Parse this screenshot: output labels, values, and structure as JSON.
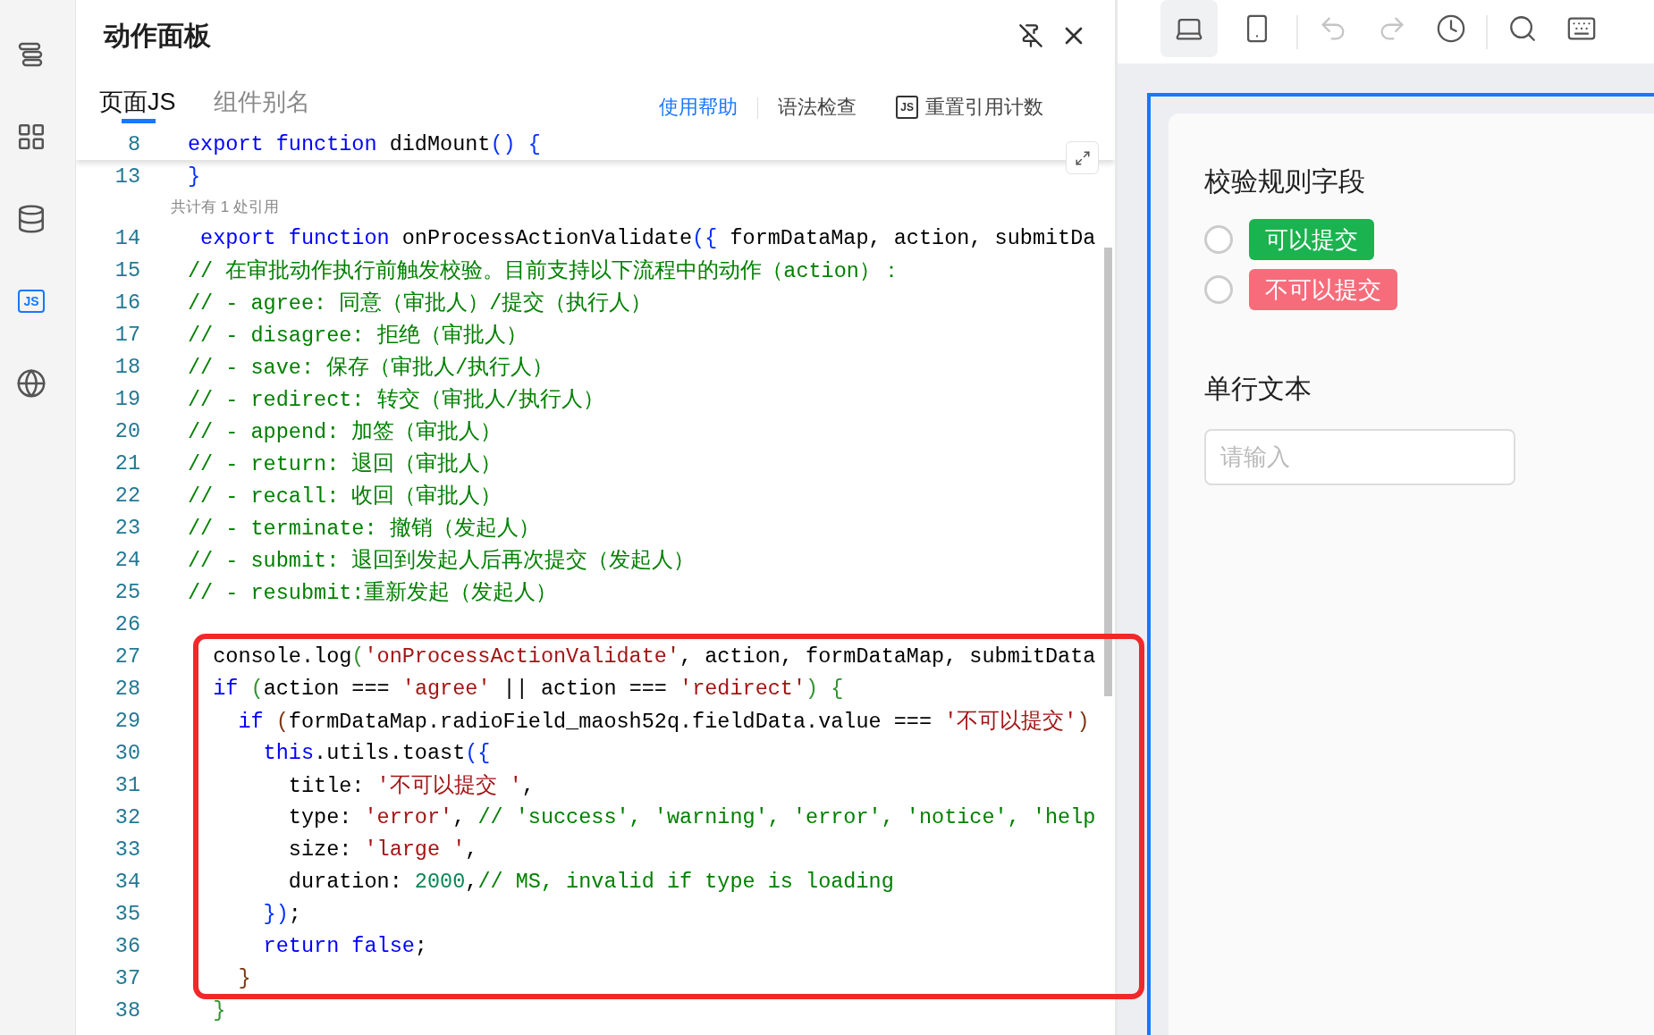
{
  "sidebar": {
    "items": [
      {
        "kind": "outline",
        "selected": false
      },
      {
        "kind": "components",
        "selected": false
      },
      {
        "kind": "data-source",
        "selected": false
      },
      {
        "kind": "js",
        "label": "JS",
        "selected": true
      },
      {
        "kind": "i18n",
        "selected": false
      }
    ]
  },
  "panel": {
    "title": "动作面板",
    "tabs": [
      {
        "label": "页面JS",
        "selected": true
      },
      {
        "label": "组件别名",
        "selected": false
      }
    ],
    "actions": [
      {
        "kind": "link",
        "label": "使用帮助"
      },
      {
        "kind": "plain",
        "label": "语法检查"
      },
      {
        "kind": "badge",
        "badge": "JS",
        "label": "重置引用计数"
      }
    ],
    "code": [
      {
        "kind": "sticky",
        "number": "8",
        "tokens": [
          {
            "kind": "kw",
            "text": "export function "
          },
          {
            "kind": "plain",
            "text": "didMount"
          },
          {
            "kind": "b1",
            "text": "() {"
          }
        ]
      },
      {
        "kind": "code",
        "number": "13",
        "tokens": [
          {
            "kind": "b1",
            "text": "}"
          }
        ]
      },
      {
        "kind": "lens",
        "text": "共计有 1 处引用"
      },
      {
        "kind": "code",
        "number": "14",
        "tokens": [
          {
            "kind": "kw",
            "text": " export function "
          },
          {
            "kind": "plain",
            "text": "onProcessActionValidate"
          },
          {
            "kind": "b1",
            "text": "({"
          },
          {
            "kind": "plain",
            "text": " formDataMap, action, submitDa"
          }
        ]
      },
      {
        "kind": "code",
        "number": "15",
        "tokens": [
          {
            "kind": "cmt",
            "text": "// 在审批动作执行前触发校验。目前支持以下流程中的动作（action）："
          }
        ]
      },
      {
        "kind": "code",
        "number": "16",
        "tokens": [
          {
            "kind": "cmt",
            "text": "// - agree: 同意（审批人）/提交（执行人）"
          }
        ]
      },
      {
        "kind": "code",
        "number": "17",
        "tokens": [
          {
            "kind": "cmt",
            "text": "// - disagree: 拒绝（审批人）"
          }
        ]
      },
      {
        "kind": "code",
        "number": "18",
        "tokens": [
          {
            "kind": "cmt",
            "text": "// - save: 保存（审批人/执行人）"
          }
        ]
      },
      {
        "kind": "code",
        "number": "19",
        "tokens": [
          {
            "kind": "cmt",
            "text": "// - redirect: 转交（审批人/执行人）"
          }
        ]
      },
      {
        "kind": "code",
        "number": "20",
        "tokens": [
          {
            "kind": "cmt",
            "text": "// - append: 加签（审批人）"
          }
        ]
      },
      {
        "kind": "code",
        "number": "21",
        "tokens": [
          {
            "kind": "cmt",
            "text": "// - return: 退回（审批人）"
          }
        ]
      },
      {
        "kind": "code",
        "number": "22",
        "tokens": [
          {
            "kind": "cmt",
            "text": "// - recall: 收回（审批人）"
          }
        ]
      },
      {
        "kind": "code",
        "number": "23",
        "tokens": [
          {
            "kind": "cmt",
            "text": "// - terminate: 撤销（发起人）"
          }
        ]
      },
      {
        "kind": "code",
        "number": "24",
        "tokens": [
          {
            "kind": "cmt",
            "text": "// - submit: 退回到发起人后再次提交（发起人）"
          }
        ]
      },
      {
        "kind": "code",
        "number": "25",
        "tokens": [
          {
            "kind": "cmt",
            "text": "// - resubmit:重新发起（发起人）"
          }
        ]
      },
      {
        "kind": "code",
        "number": "26"
      },
      {
        "kind": "code",
        "number": "27",
        "tokens": [
          {
            "kind": "plain",
            "text": "  console.log"
          },
          {
            "kind": "b2",
            "text": "("
          },
          {
            "kind": "str",
            "text": "'onProcessActionValidate'"
          },
          {
            "kind": "plain",
            "text": ", action, formDataMap, submitData"
          }
        ]
      },
      {
        "kind": "code",
        "number": "28",
        "tokens": [
          {
            "kind": "kw",
            "text": "  if"
          },
          {
            "kind": "b2",
            "text": " ("
          },
          {
            "kind": "plain",
            "text": "action === "
          },
          {
            "kind": "str",
            "text": "'agree'"
          },
          {
            "kind": "plain",
            "text": " || action === "
          },
          {
            "kind": "str",
            "text": "'redirect'"
          },
          {
            "kind": "b2",
            "text": ") {"
          }
        ]
      },
      {
        "kind": "code",
        "number": "29",
        "tokens": [
          {
            "kind": "kw",
            "text": "    if"
          },
          {
            "kind": "b3",
            "text": " ("
          },
          {
            "kind": "plain",
            "text": "formDataMap.radioField_maosh52q.fieldData.value === "
          },
          {
            "kind": "str",
            "text": "'不可以提交'"
          },
          {
            "kind": "b3",
            "text": ")"
          }
        ]
      },
      {
        "kind": "code",
        "number": "30",
        "tokens": [
          {
            "kind": "kw",
            "text": "      this"
          },
          {
            "kind": "plain",
            "text": ".utils.toast"
          },
          {
            "kind": "b1",
            "text": "({"
          }
        ]
      },
      {
        "kind": "code",
        "number": "31",
        "tokens": [
          {
            "kind": "plain",
            "text": "        title: "
          },
          {
            "kind": "str",
            "text": "'不可以提交 '"
          },
          {
            "kind": "plain",
            "text": ","
          }
        ]
      },
      {
        "kind": "code",
        "number": "32",
        "tokens": [
          {
            "kind": "plain",
            "text": "        type: "
          },
          {
            "kind": "str",
            "text": "'error'"
          },
          {
            "kind": "plain",
            "text": ", "
          },
          {
            "kind": "cmt",
            "text": "// 'success', 'warning', 'error', 'notice', 'help"
          }
        ]
      },
      {
        "kind": "code",
        "number": "33",
        "tokens": [
          {
            "kind": "plain",
            "text": "        size: "
          },
          {
            "kind": "str",
            "text": "'large '"
          },
          {
            "kind": "plain",
            "text": ","
          }
        ]
      },
      {
        "kind": "code",
        "number": "34",
        "tokens": [
          {
            "kind": "plain",
            "text": "        duration: "
          },
          {
            "kind": "num",
            "text": "2000"
          },
          {
            "kind": "plain",
            "text": ","
          },
          {
            "kind": "cmt",
            "text": "// MS, invalid if type is loading"
          }
        ]
      },
      {
        "kind": "code",
        "number": "35",
        "tokens": [
          {
            "kind": "b1",
            "text": "      })"
          },
          {
            "kind": "plain",
            "text": ";"
          }
        ]
      },
      {
        "kind": "code",
        "number": "36",
        "tokens": [
          {
            "kind": "kw",
            "text": "      return false"
          },
          {
            "kind": "plain",
            "text": ";"
          }
        ]
      },
      {
        "kind": "code",
        "number": "37",
        "tokens": [
          {
            "kind": "b3",
            "text": "    }"
          }
        ]
      },
      {
        "kind": "code",
        "number": "38",
        "tokens": [
          {
            "kind": "b2",
            "text": "  }"
          }
        ]
      }
    ]
  },
  "toolbar": {
    "devices": [
      {
        "kind": "desktop",
        "selected": true
      },
      {
        "kind": "mobile",
        "selected": false
      }
    ],
    "history": [
      {
        "kind": "undo",
        "disabled": true
      },
      {
        "kind": "redo",
        "disabled": true
      }
    ]
  },
  "form": {
    "fields": [
      {
        "kind": "radio",
        "label": "校验规则字段",
        "options": [
          {
            "text": "可以提交",
            "color": "#1bb34f",
            "selected": false
          },
          {
            "text": "不可以提交",
            "color": "#f76c7b",
            "selected": false
          }
        ]
      },
      {
        "kind": "text",
        "label": "单行文本",
        "placeholder": "请输入"
      }
    ]
  }
}
